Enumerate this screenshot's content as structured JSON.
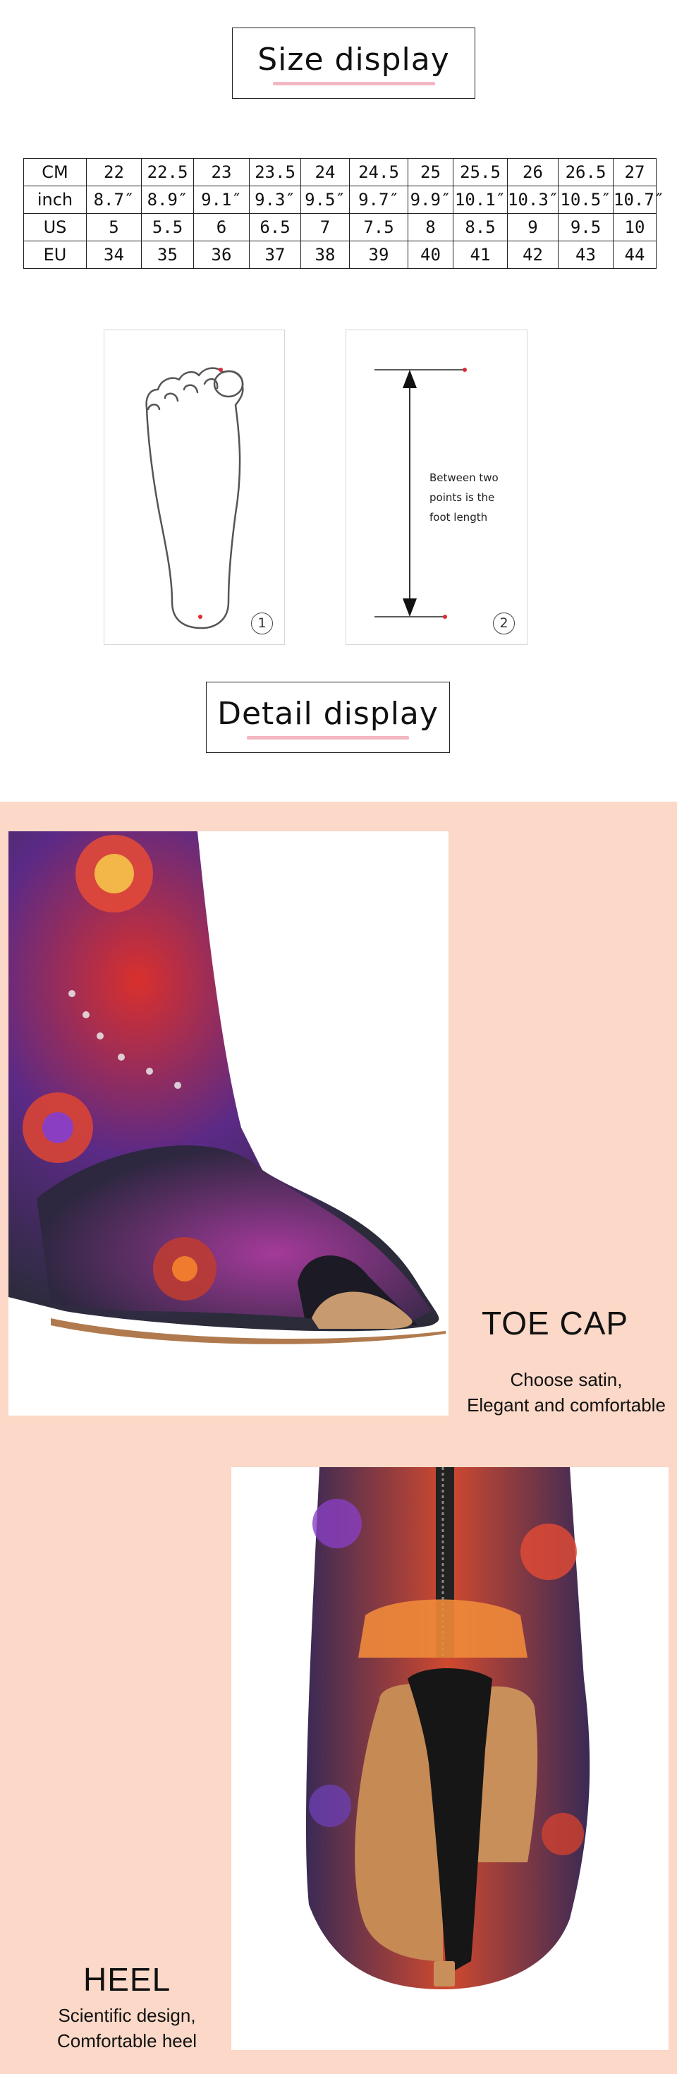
{
  "size_section": {
    "title": "Size display",
    "table": {
      "rows": [
        {
          "label": "CM",
          "values": [
            "22",
            "22.5",
            "23",
            "23.5",
            "24",
            "24.5",
            "25",
            "25.5",
            "26",
            "26.5",
            "27"
          ]
        },
        {
          "label": "inch",
          "values": [
            "8.7″",
            "8.9″",
            "9.1″",
            "9.3″",
            "9.5″",
            "9.7″",
            "9.9″",
            "10.1″",
            "10.3″",
            "10.5″",
            "10.7″"
          ]
        },
        {
          "label": "US",
          "values": [
            "5",
            "5.5",
            "6",
            "6.5",
            "7",
            "7.5",
            "8",
            "8.5",
            "9",
            "9.5",
            "10"
          ]
        },
        {
          "label": "EU",
          "values": [
            "34",
            "35",
            "36",
            "37",
            "38",
            "39",
            "40",
            "41",
            "42",
            "43",
            "44"
          ]
        }
      ]
    },
    "diagram": {
      "panel1_number": "1",
      "panel2_number": "2",
      "length_note": "Between two points is the foot length"
    }
  },
  "detail_section": {
    "title": "Detail display",
    "toe_cap": {
      "title": "TOE CAP",
      "desc_line1": "Choose satin,",
      "desc_line2": "Elegant and comfortable"
    },
    "heel": {
      "title": "HEEL",
      "desc_line1": "Scientific design,",
      "desc_line2": "Comfortable heel"
    }
  },
  "colors": {
    "accent_pink": "#f3b7c2",
    "background_peach": "#fbd8c7",
    "marker_red": "#e0283a"
  }
}
